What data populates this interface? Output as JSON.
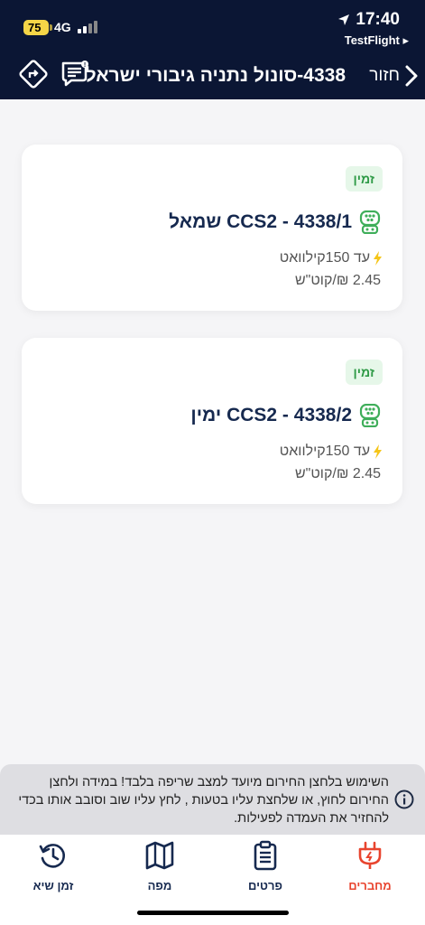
{
  "status_bar": {
    "battery": "75",
    "network": "4G",
    "time": "17:40",
    "back_app": "TestFlight ▸"
  },
  "header": {
    "back_label": "חזור",
    "title": "4338-סונול נתניה גיבורי ישראל"
  },
  "connectors": [
    {
      "status": "זמין",
      "title": "4338/1 - CCS2 שמאל",
      "power": "עד 150קילוואט",
      "price": "2.45 ₪/קוט\"ש"
    },
    {
      "status": "זמין",
      "title": "4338/2 - CCS2 ימין",
      "power": "עד 150קילוואט",
      "price": "2.45 ₪/קוט\"ש"
    }
  ],
  "notice": {
    "text": "השימוש בלחצן החירום מיועד למצב שריפה בלבד! במידה ולחצן החירום לחוץ, או שלחצת עליו בטעות , לחץ עליו שוב וסובב אותו בכדי להחזיר את העמדה לפעילות."
  },
  "tabs": [
    {
      "label": "מחברים",
      "icon": "plug-icon",
      "active": true
    },
    {
      "label": "פרטים",
      "icon": "clipboard-icon",
      "active": false
    },
    {
      "label": "מפה",
      "icon": "map-icon",
      "active": false
    },
    {
      "label": "זמן שיא",
      "icon": "clock-history-icon",
      "active": false
    }
  ],
  "colors": {
    "header_bg": "#0b1634",
    "accent_active": "#e8442e",
    "available_green": "#2e9a46",
    "bolt_yellow": "#f5c518"
  }
}
